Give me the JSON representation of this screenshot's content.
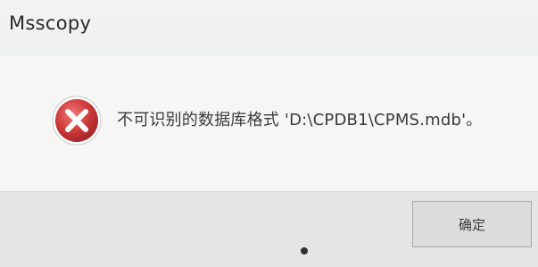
{
  "window": {
    "title": "Msscopy"
  },
  "dialog": {
    "icon": "error-icon",
    "message": "不可识别的数据库格式 'D:\\CPDB1\\CPMS.mdb'。"
  },
  "buttons": {
    "ok_label": "确定"
  },
  "colors": {
    "error_red": "#c9383a",
    "background": "#eef0ee"
  }
}
